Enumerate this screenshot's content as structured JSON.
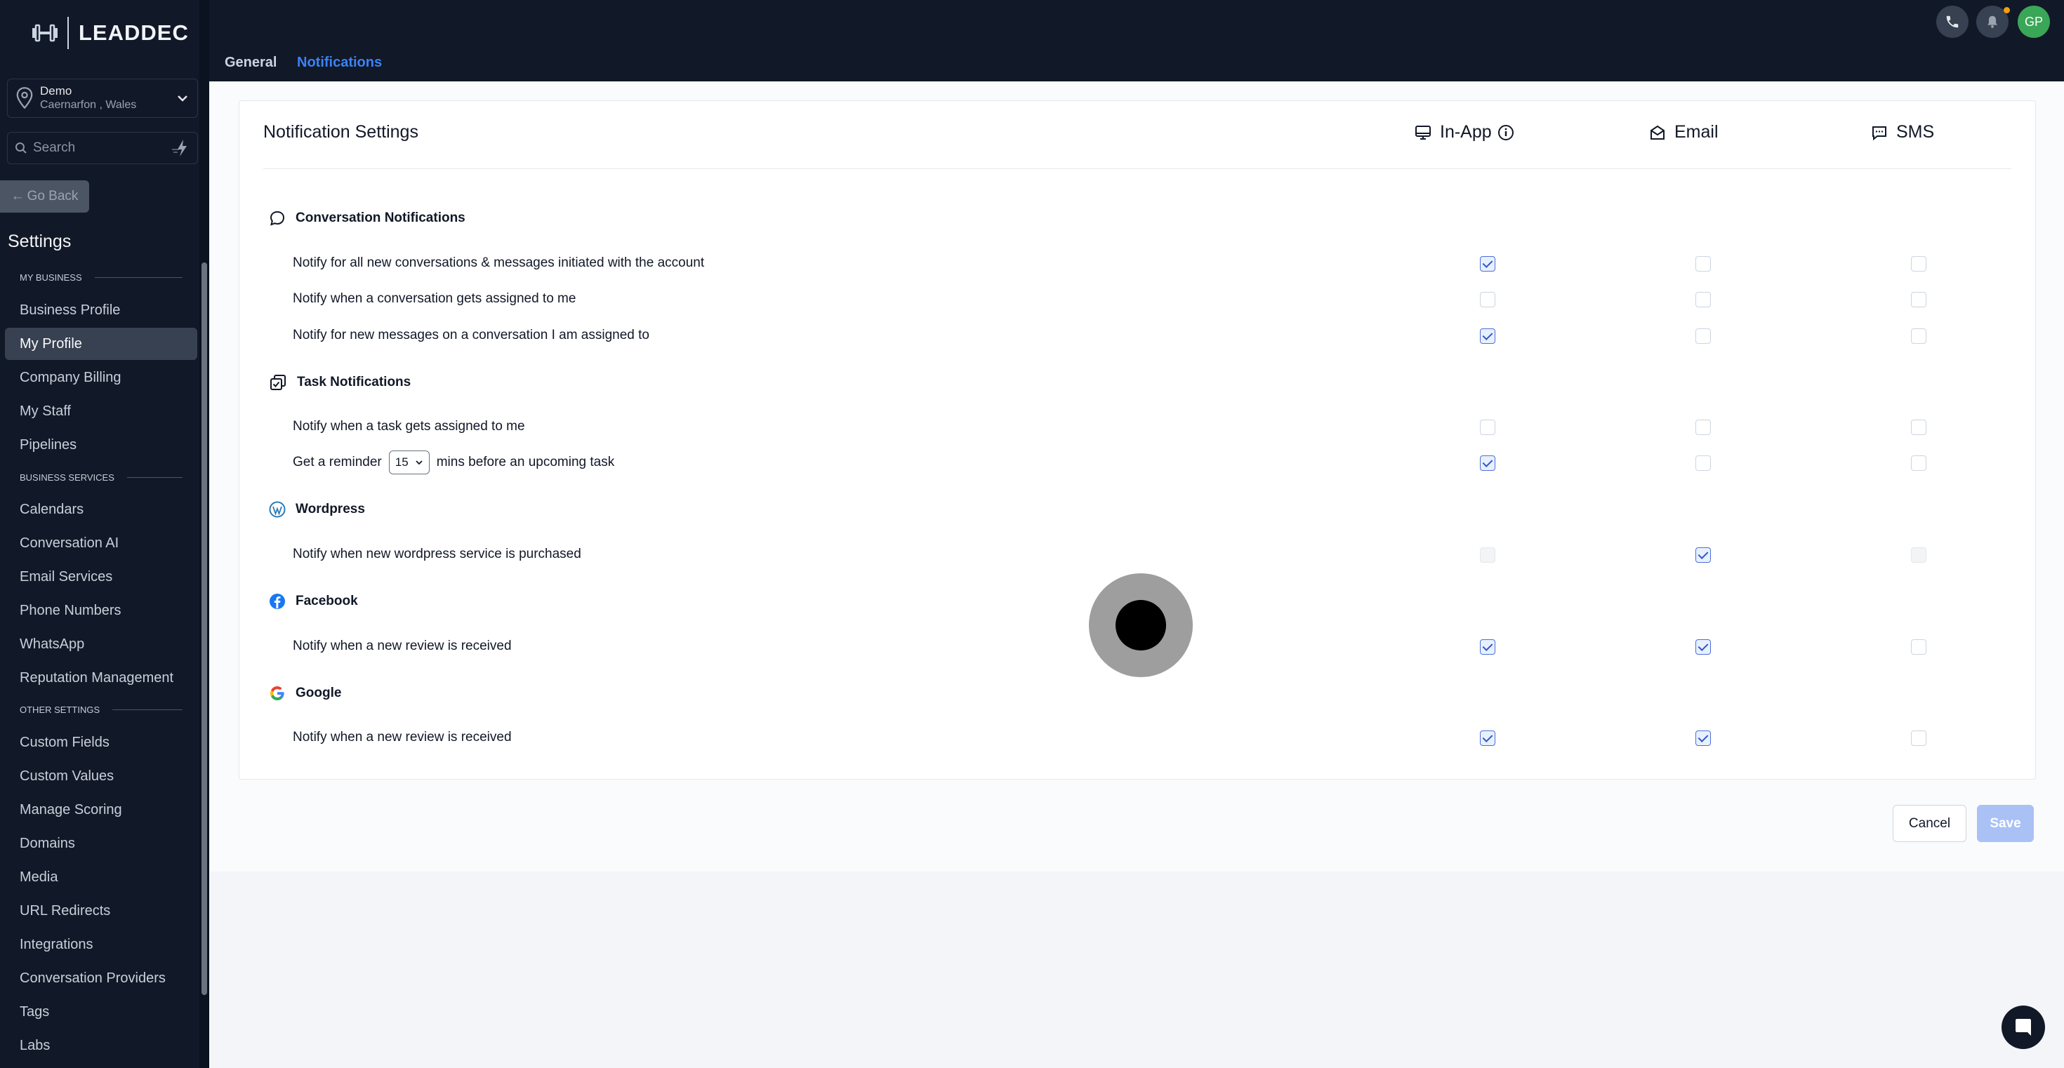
{
  "brand": "LEADDEC",
  "location": {
    "name": "Demo",
    "address": "Caernarfon , Wales"
  },
  "search": {
    "placeholder": "Search"
  },
  "go_back": "Go Back",
  "settings_title": "Settings",
  "sidebar": {
    "sections": [
      {
        "heading": "MY BUSINESS",
        "items": [
          "Business Profile",
          "My Profile",
          "Company Billing",
          "My Staff",
          "Pipelines"
        ]
      },
      {
        "heading": "BUSINESS SERVICES",
        "items": [
          "Calendars",
          "Conversation AI",
          "Email Services",
          "Phone Numbers",
          "WhatsApp",
          "Reputation Management"
        ]
      },
      {
        "heading": "OTHER SETTINGS",
        "items": [
          "Custom Fields",
          "Custom Values",
          "Manage Scoring",
          "Domains",
          "Media",
          "URL Redirects",
          "Integrations",
          "Conversation Providers",
          "Tags",
          "Labs"
        ]
      }
    ],
    "active_item": "My Profile"
  },
  "tabs": {
    "general": "General",
    "notifications": "Notifications",
    "active": "Notifications"
  },
  "user_initials": "GP",
  "card": {
    "title": "Notification Settings",
    "channels": {
      "in_app": "In-App",
      "email": "Email",
      "sms": "SMS"
    }
  },
  "groups": [
    {
      "title": "Conversation Notifications",
      "icon": "chat-bubble-icon",
      "rows": [
        {
          "label": "Notify for all new conversations & messages initiated with the account",
          "in_app": "checked",
          "email": "unchecked",
          "sms": "unchecked"
        },
        {
          "label": "Notify when a conversation gets assigned to me",
          "in_app": "unchecked",
          "email": "unchecked",
          "sms": "unchecked"
        },
        {
          "label": "Notify for new messages on a conversation I am assigned to",
          "in_app": "checked",
          "email": "unchecked",
          "sms": "unchecked"
        }
      ]
    },
    {
      "title": "Task Notifications",
      "icon": "task-icon",
      "rows": [
        {
          "label": "Notify when a task gets assigned to me",
          "in_app": "unchecked",
          "email": "unchecked",
          "sms": "unchecked"
        },
        {
          "label_prefix": "Get a reminder",
          "select_value": "15",
          "label_suffix": "mins before an upcoming task",
          "in_app": "checked",
          "email": "unchecked",
          "sms": "unchecked"
        }
      ]
    },
    {
      "title": "Wordpress",
      "icon": "wordpress-icon",
      "rows": [
        {
          "label": "Notify when new wordpress service is purchased",
          "in_app": "disabled",
          "email": "checked",
          "sms": "disabled"
        }
      ]
    },
    {
      "title": "Facebook",
      "icon": "facebook-icon",
      "rows": [
        {
          "label": "Notify when a new review is received",
          "in_app": "checked",
          "email": "checked",
          "sms": "unchecked"
        }
      ]
    },
    {
      "title": "Google",
      "icon": "google-icon",
      "rows": [
        {
          "label": "Notify when a new review is received",
          "in_app": "checked",
          "email": "checked",
          "sms": "unchecked"
        }
      ]
    }
  ],
  "buttons": {
    "cancel": "Cancel",
    "save": "Save"
  },
  "colors": {
    "sidebar_bg": "#111827",
    "accent": "#3b82f6",
    "save_disabled": "#a9c1f5",
    "avatar": "#3aa657",
    "notification_dot": "#f59e0b"
  }
}
